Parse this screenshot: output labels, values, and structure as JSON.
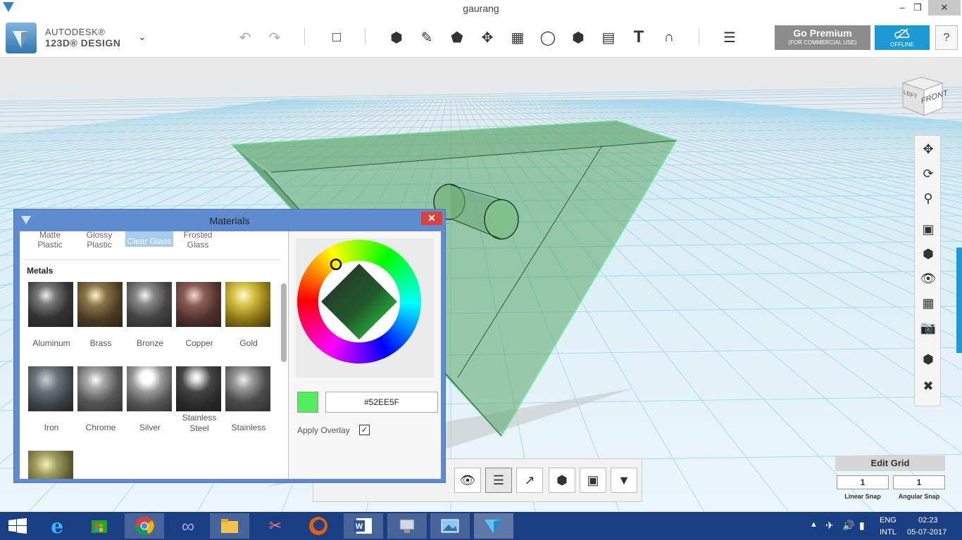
{
  "window": {
    "title": "gaurang",
    "min": "–",
    "max": "❒",
    "close": "✕"
  },
  "brand": {
    "line1": "AUTODESK®",
    "line2": "123D® DESIGN",
    "menu_icon": "chevron-down-icon"
  },
  "toolbar": {
    "undo": "undo-icon",
    "redo": "redo-icon",
    "tools": [
      "primitives-icon",
      "sketch-icon",
      "construct-icon",
      "modify-icon",
      "pattern-icon",
      "group-icon",
      "combine-icon",
      "measure-icon",
      "text-icon",
      "snap-icon",
      "material-icon"
    ],
    "premium_label": "Go Premium",
    "premium_sub": "(FOR COMMERCIAL USE)",
    "offline_label": "OFFLINE",
    "help_label": "?"
  },
  "viewcube": {
    "left": "LEFT",
    "front": "FRONT"
  },
  "navbar": [
    "pan-icon",
    "orbit-icon",
    "zoom-icon",
    "fit-icon",
    "views-icon",
    "visibility-icon",
    "grid-icon",
    "screenshot-icon",
    "material-visibility-icon",
    "hide-icon"
  ],
  "edit_grid": {
    "title": "Edit Grid",
    "linear_value": "1",
    "angular_value": "1",
    "linear_label": "Linear Snap",
    "angular_label": "Angular Snap"
  },
  "materials": {
    "title": "Materials",
    "close": "✕",
    "prev_row": [
      "Matte\nPlastic",
      "Glossy\nPlastic",
      "Clear Glass",
      "Frosted\nGlass"
    ],
    "prev_selected": "Clear Glass",
    "section": "Metals",
    "items_row1": [
      "Aluminum",
      "Brass",
      "Bronze",
      "Copper",
      "Gold"
    ],
    "items_row2": [
      "Iron",
      "Chrome",
      "Silver",
      "Stainless\nSteel",
      "Stainless"
    ],
    "hex_value": "#52EE5F",
    "current_color": "#52EE5F",
    "apply_overlay_label": "Apply Overlay",
    "apply_overlay_checked": "✓"
  },
  "taskbar": {
    "apps": [
      "internet-explorer-icon",
      "store-icon",
      "chrome-icon",
      "infinity-icon",
      "file-explorer-icon",
      "snipping-icon",
      "firefox-icon",
      "word-icon",
      "network-icon",
      "photos-icon",
      "123d-design-icon"
    ],
    "lang1": "ENG",
    "lang2": "INTL",
    "time": "02:23",
    "date": "05-07-2017"
  }
}
